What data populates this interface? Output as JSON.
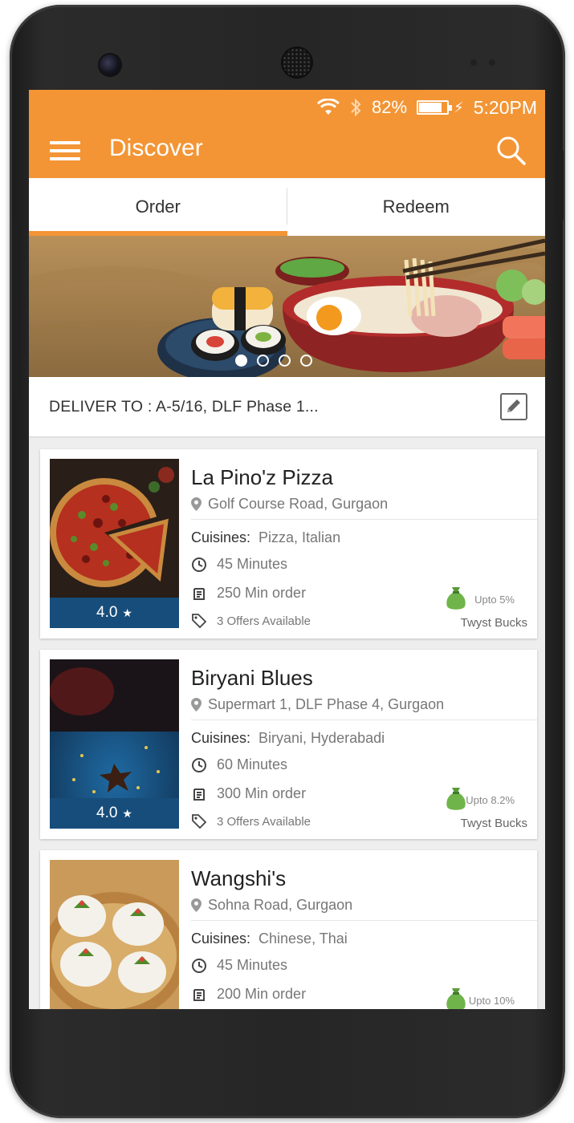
{
  "status": {
    "battery_percent": "82%",
    "battery_level": 0.82,
    "time": "5:20PM"
  },
  "appbar": {
    "title": "Discover",
    "color": "#f39535"
  },
  "tabs": [
    {
      "label": "Order",
      "active": true
    },
    {
      "label": "Redeem",
      "active": false
    }
  ],
  "banner": {
    "slides": 4,
    "active_slide": 0
  },
  "delivery": {
    "text": "DELIVER TO : A-5/16, DLF Phase 1..."
  },
  "restaurants": [
    {
      "name": "La Pino'z Pizza",
      "location": "Golf Course Road, Gurgaon",
      "cuisines_label": "Cuisines:",
      "cuisines": "Pizza, Italian",
      "time": "45 Minutes",
      "min_order": "250 Min order",
      "offers": "3 Offers Available",
      "rating": "4.0",
      "bucks_pct": "Upto 5%",
      "bucks_name": "Twyst Bucks"
    },
    {
      "name": "Biryani Blues",
      "location": "Supermart 1, DLF Phase 4, Gurgaon",
      "cuisines_label": "Cuisines:",
      "cuisines": "Biryani, Hyderabadi",
      "time": "60 Minutes",
      "min_order": "300 Min order",
      "offers": "3 Offers Available",
      "rating": "4.0",
      "bucks_pct": "Upto 8.2%",
      "bucks_name": "Twyst Bucks"
    },
    {
      "name": "Wangshi's",
      "location": "Sohna Road, Gurgaon",
      "cuisines_label": "Cuisines:",
      "cuisines": "Chinese, Thai",
      "time": "45 Minutes",
      "min_order": "200 Min order",
      "offers": "",
      "rating": "",
      "bucks_pct": "Upto 10%",
      "bucks_name": ""
    }
  ]
}
